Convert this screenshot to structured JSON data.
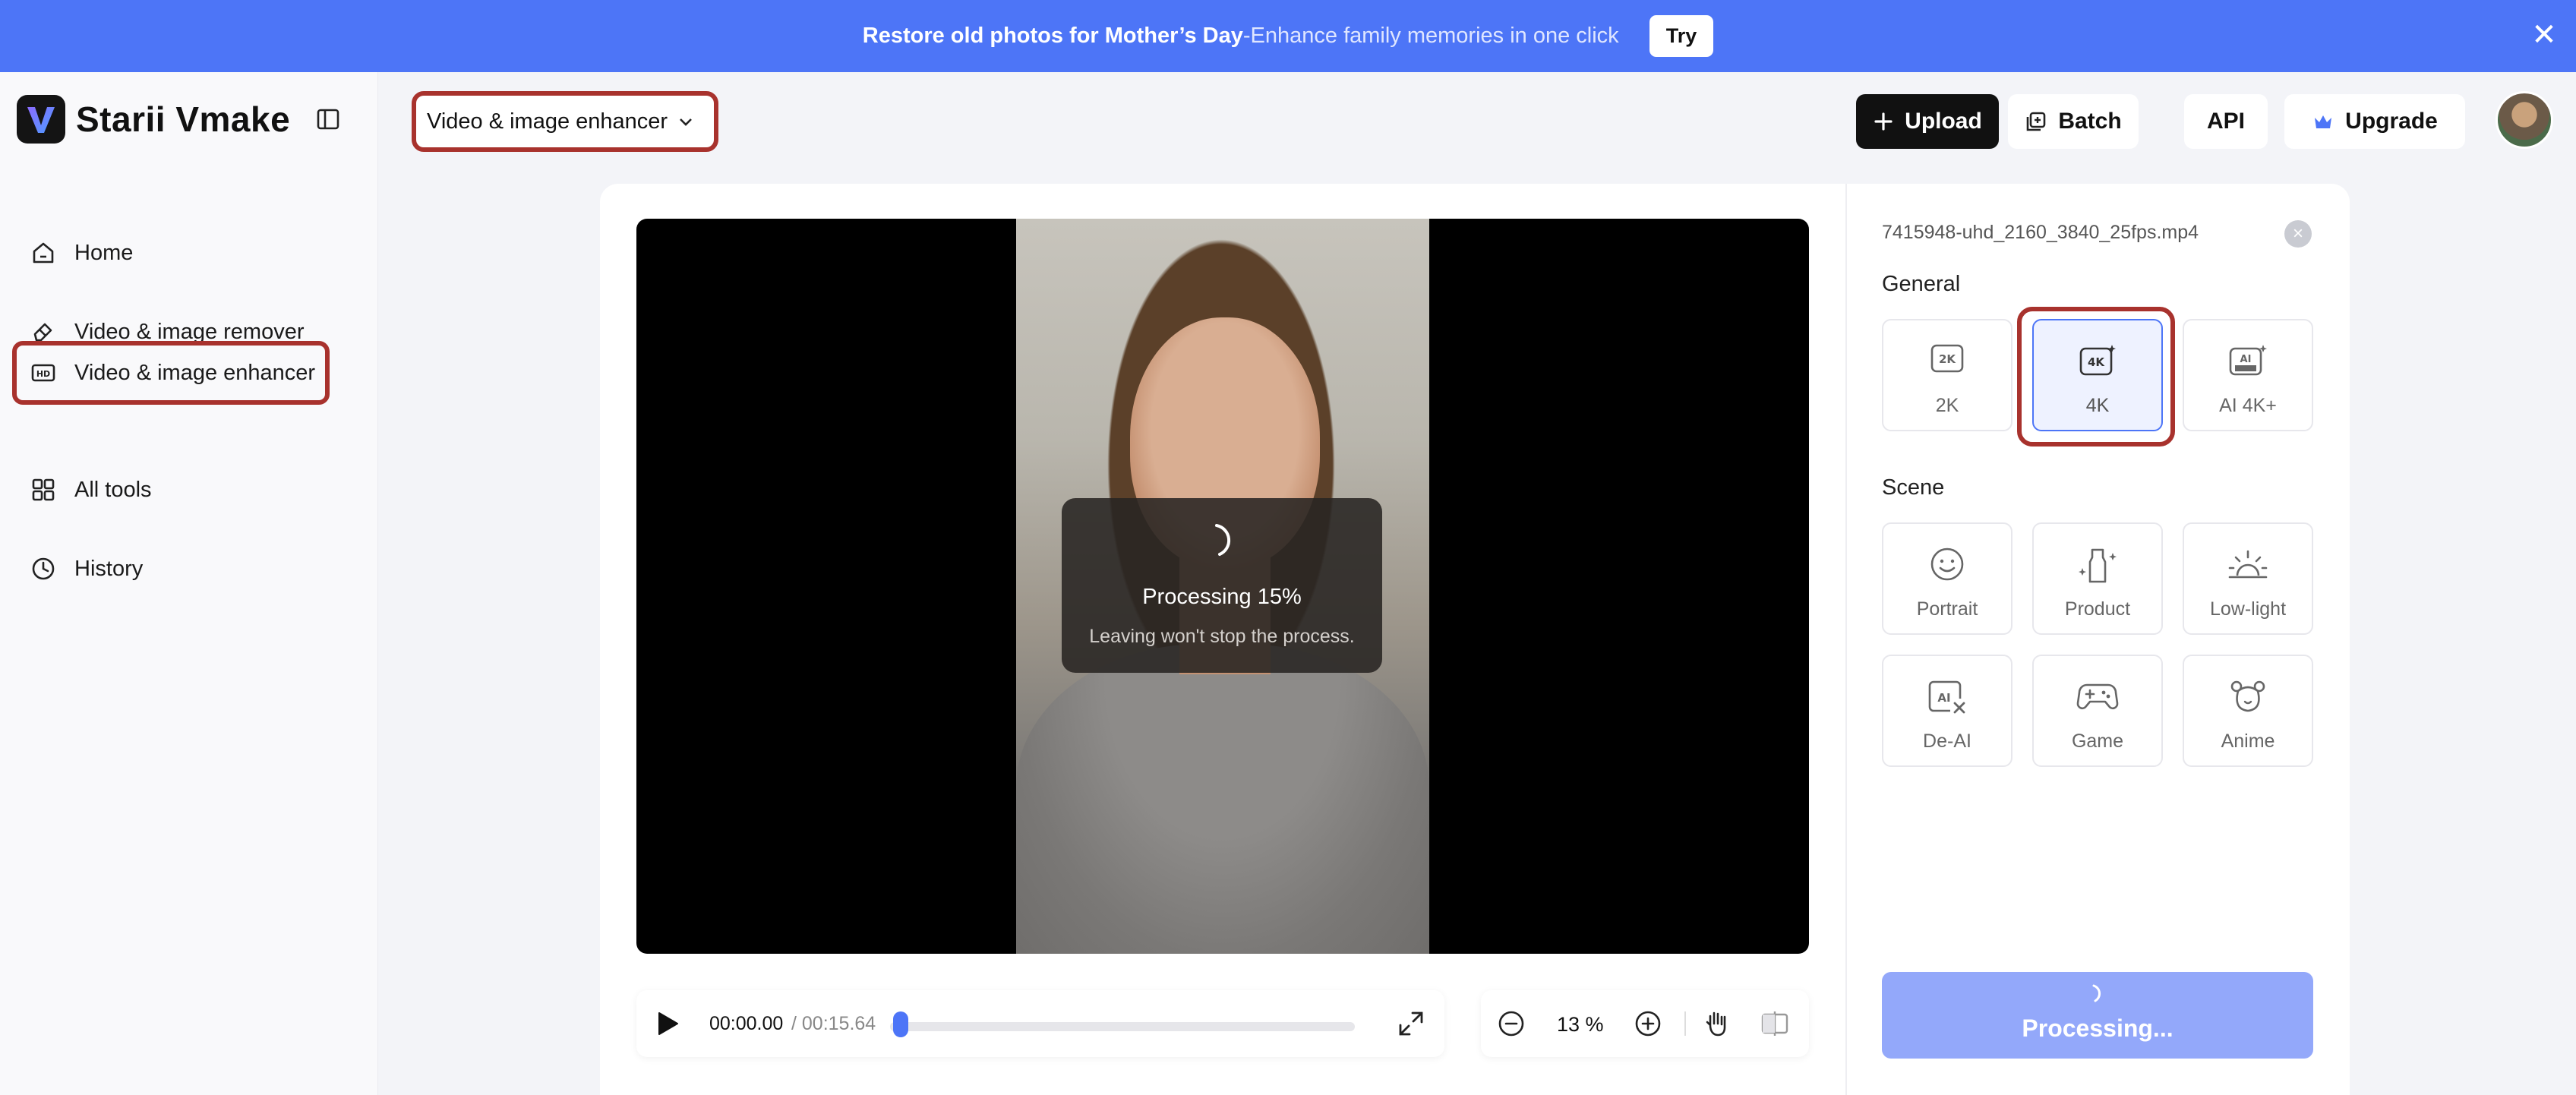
{
  "banner": {
    "title": "Restore old photos for Mother’s Day",
    "subtitle": " -Enhance family memories in one click",
    "try_label": "Try",
    "close": "✕"
  },
  "sidebar": {
    "brand": "Starii Vmake",
    "items": [
      {
        "label": "Home",
        "icon": "home-icon"
      },
      {
        "label": "Video & image remover",
        "icon": "eraser-icon"
      },
      {
        "label": "Video & image enhancer",
        "icon": "hd-icon",
        "active": true
      },
      {
        "label": "All tools",
        "icon": "grid-icon"
      },
      {
        "label": "History",
        "icon": "clock-icon"
      }
    ]
  },
  "header": {
    "tool_select": "Video & image enhancer",
    "upload": "Upload",
    "batch": "Batch",
    "api": "API",
    "upgrade": "Upgrade"
  },
  "video": {
    "processing": "Processing 15%",
    "processing_progress": 0.15,
    "note": "Leaving won't stop the process."
  },
  "player": {
    "current": "00:00.00",
    "total": "/ 00:15.64",
    "zoom": "13 %"
  },
  "panel": {
    "filename": "7415948-uhd_2160_3840_25fps.mp4",
    "general_label": "General",
    "scene_label": "Scene",
    "general_options": [
      {
        "label": "2K",
        "icon": "2k-icon"
      },
      {
        "label": "4K",
        "icon": "4k-icon",
        "selected": true
      },
      {
        "label": "AI 4K+",
        "icon": "ai-ultra-icon"
      }
    ],
    "scene_options": [
      {
        "label": "Portrait",
        "icon": "smile-icon"
      },
      {
        "label": "Product",
        "icon": "bottle-icon"
      },
      {
        "label": "Low-light",
        "icon": "sunrise-icon"
      },
      {
        "label": "De-AI",
        "icon": "de-ai-icon"
      },
      {
        "label": "Game",
        "icon": "gamepad-icon"
      },
      {
        "label": "Anime",
        "icon": "bear-icon"
      }
    ],
    "process_button": "Processing..."
  },
  "colors": {
    "accent": "#4d75f7",
    "highlight": "#a8322d",
    "banner": "#4d75f7"
  }
}
